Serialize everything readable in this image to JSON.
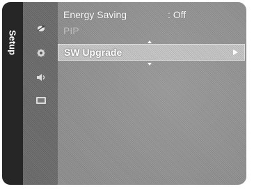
{
  "side_tab": {
    "label": "Setup"
  },
  "menu": {
    "items": [
      {
        "label": "Energy Saving",
        "value": ": Off",
        "state": "enabled"
      },
      {
        "label": "PIP",
        "state": "disabled"
      },
      {
        "label": "SW Upgrade",
        "state": "selected"
      }
    ]
  },
  "icons": [
    "signal-icon",
    "gear-icon",
    "speaker-icon",
    "input-icon"
  ]
}
